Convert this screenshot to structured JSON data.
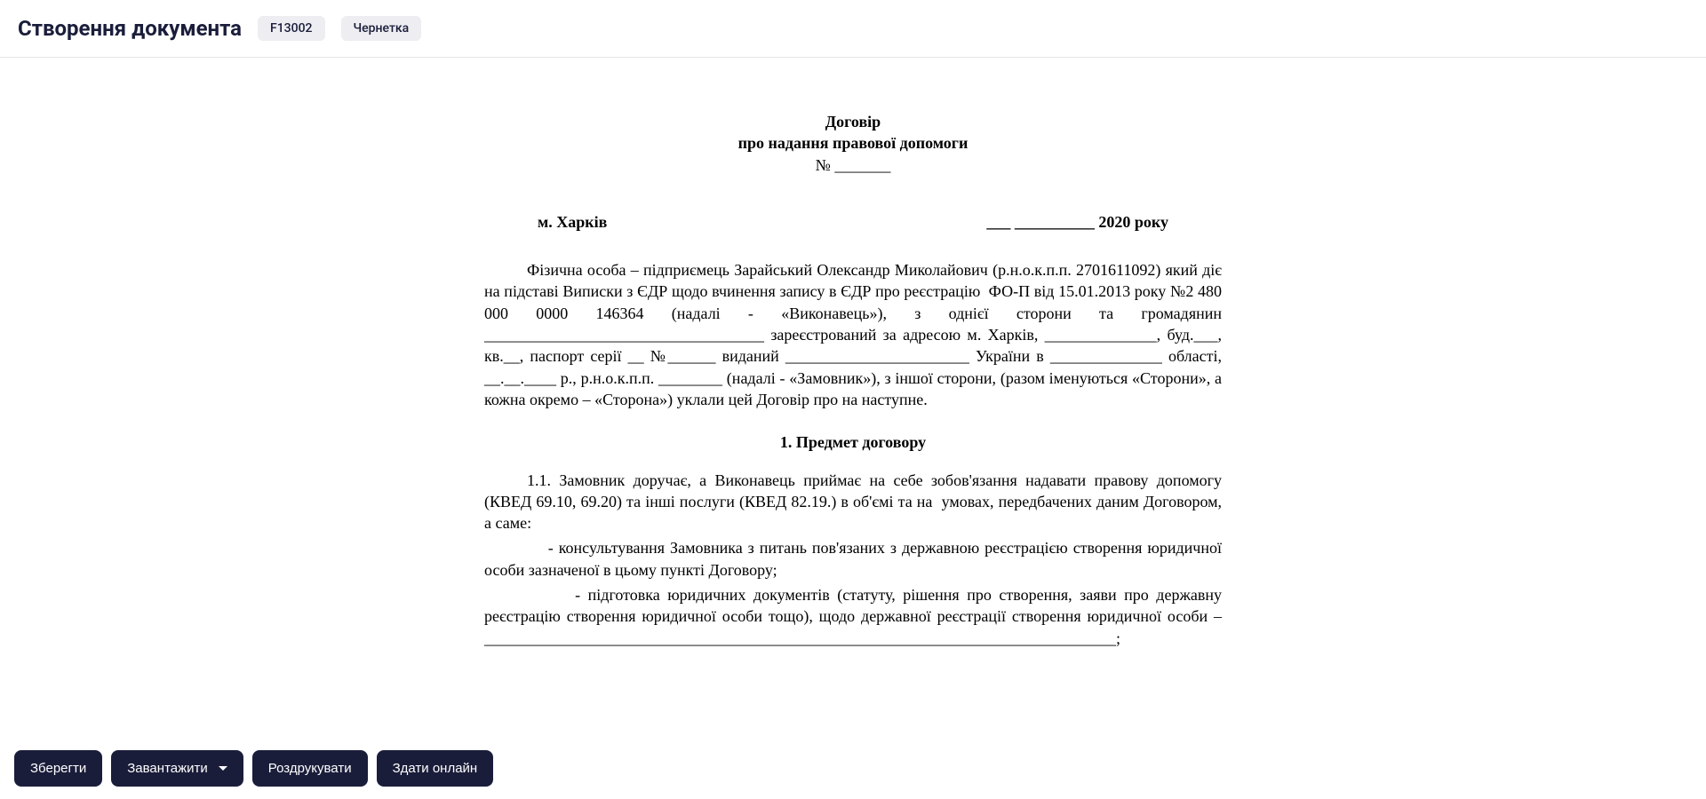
{
  "header": {
    "title": "Створення документа",
    "code_badge": "F13002",
    "status_badge": "Чернетка"
  },
  "document": {
    "title_line1": "Договір",
    "title_line2": "про надання правової допомоги",
    "number_label": "№ _______",
    "city": "м. Харків",
    "year_line": "___ __________ 2020 року",
    "intro": "Фізична особа – підприємець Зарайський Олександр Миколайович (р.н.о.к.п.п. 2701611092) який діє на підставі Виписки з ЄДР щодо вчинення запису в ЄДР про реєстрацію  ФО-П від 15.01.2013 року №2 480 000 0000 146364 (надалі - «Виконавець»), з однієї сторони та громадянин ___________________________________ зареєстрований за адресою м. Харків, ______________, буд.___, кв.__, паспорт серії __ №______ виданий _______________________ України в ______________ області, __.__.____ р., р.н.о.к.п.п. ________ (надалі - «Замовник»), з іншої сторони, (разом іменуються «Сторони», а кожна окремо – «Сторона») уклали цей Договір про на наступне.",
    "section1_title": "1. Предмет договору",
    "clause_1_1": "1.1. Замовник доручає, а Виконавець приймає на себе зобов'язання надавати правову допомогу (КВЕД 69.10, 69.20) та інші послуги (КВЕД 82.19.) в об'ємі та на  умовах, передбачених даним Договором, а саме:",
    "bullet1": "            - консультування Замовника з питань пов'язаних з державною реєстрацією створення юридичної особи зазначеної в цьому пункті Договору;",
    "bullet2": "            - підготовка юридичних документів (статуту, рішення про створення, заяви про державну реєстрацію створення юридичної особи тощо), щодо державної реєстрації створення юридичної особи – _______________________________________________________________________________;"
  },
  "footer": {
    "save": "Зберегти",
    "download": "Завантажити",
    "print": "Роздрукувати",
    "submit": "Здати онлайн"
  }
}
